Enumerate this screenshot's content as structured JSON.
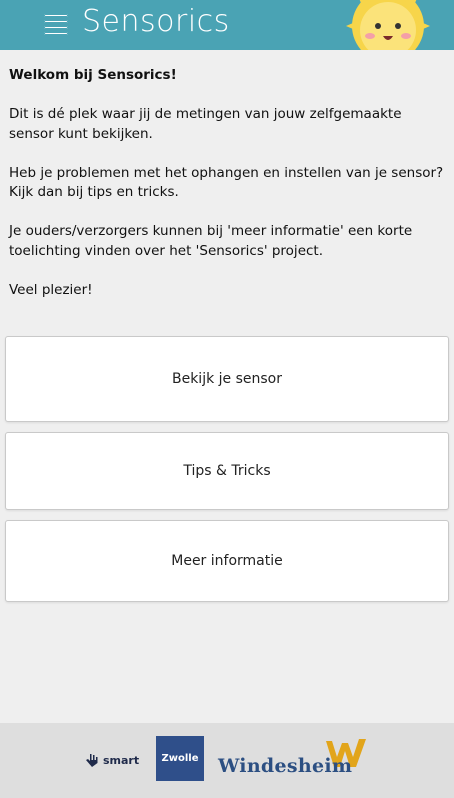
{
  "header": {
    "title": "Sensorics",
    "menu_icon": "hamburger-menu-icon",
    "mascot_icon": "sun-mascot-icon",
    "background_color": "#4aa3b4"
  },
  "intro": {
    "welcome": "Welkom bij Sensorics!",
    "paragraph1": "Dit is dé plek waar jij de metingen van jouw zelfgemaakte sensor kunt bekijken.",
    "paragraph2": "Heb je problemen met het ophangen en instellen van je sensor? Kijk dan bij tips en tricks.",
    "paragraph3": "Je ouders/verzorgers kunnen bij 'meer informatie' een korte toelichting vinden over het 'Sensorics' project.",
    "paragraph4": "Veel plezier!"
  },
  "menu": {
    "items": [
      {
        "label": "Bekijk je sensor"
      },
      {
        "label": "Tips & Tricks"
      },
      {
        "label": "Meer informatie"
      }
    ]
  },
  "footer": {
    "logos": [
      {
        "name": "smart",
        "label": "smart"
      },
      {
        "name": "zwolle",
        "label": "Zwolle"
      },
      {
        "name": "windesheim",
        "label": "Windesheim"
      }
    ]
  }
}
